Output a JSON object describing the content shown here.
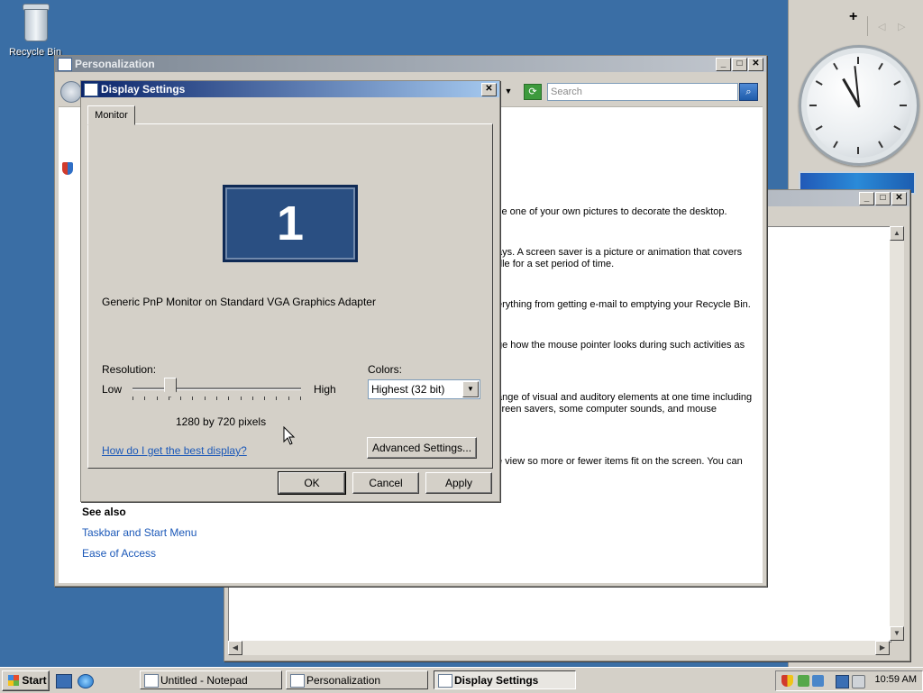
{
  "desktop": {
    "recycle_bin_label": "Recycle Bin"
  },
  "sidebar": {
    "add_label": "+",
    "prev_label": "◁",
    "next_label": "▷"
  },
  "personalization": {
    "title": "Personalization",
    "search_placeholder": "Search",
    "texts": [
      "se one of your own pictures to decorate the desktop.",
      "ays. A screen saver is a picture or animation that covers\ndle for a set period of time.",
      "erything from getting e-mail to emptying your Recycle Bin.",
      "ge how the mouse pointer looks during such activities as",
      "ange of visual and auditory elements at one time including\ncreen savers, some computer sounds, and mouse",
      "e view so more or fewer items fit on the screen. You can"
    ],
    "see_also": "See also",
    "link_taskbar": "Taskbar and Start Menu",
    "link_ease": "Ease of Access"
  },
  "display_settings": {
    "title": "Display Settings",
    "tab_monitor": "Monitor",
    "monitor_number": "1",
    "monitor_description": "Generic PnP Monitor on Standard VGA Graphics Adapter",
    "resolution_label": "Resolution:",
    "low_label": "Low",
    "high_label": "High",
    "resolution_value": "1280 by 720 pixels",
    "resolution_slider_fraction": 0.22,
    "colors_label": "Colors:",
    "colors_value": "Highest (32 bit)",
    "help_link": "How do I get the best display?",
    "advanced_button": "Advanced Settings...",
    "ok_button": "OK",
    "cancel_button": "Cancel",
    "apply_button": "Apply"
  },
  "taskbar": {
    "start_label": "Start",
    "tasks": [
      {
        "label": "Untitled - Notepad"
      },
      {
        "label": "Personalization"
      },
      {
        "label": "Display Settings"
      }
    ],
    "time": "10:59 AM"
  },
  "colors": {
    "desktop": "#3a6ea5",
    "title_active_start": "#0a246a",
    "link": "#1b58b8"
  }
}
